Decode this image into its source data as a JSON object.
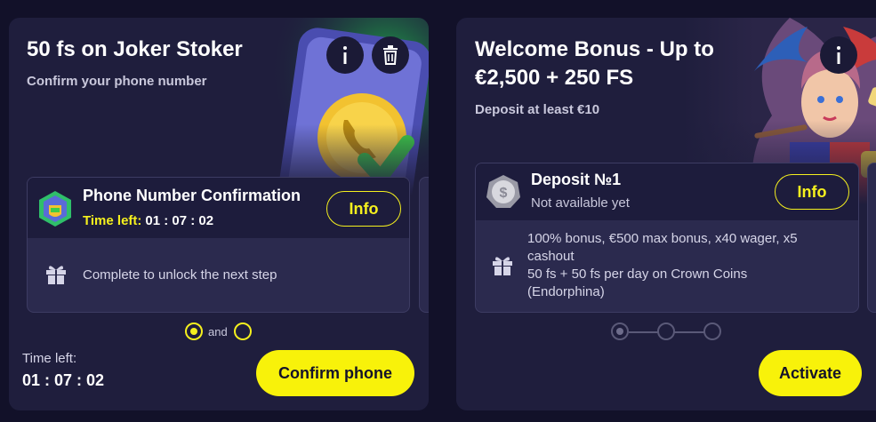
{
  "cards": [
    {
      "title": "50 fs on Joker Stoker",
      "subtitle": "Confirm your phone number",
      "step": {
        "title": "Phone Number Confirmation",
        "time_label": "Time left:",
        "time_value": "01 : 07 : 02",
        "info_label": "Info",
        "description": "Complete to unlock the next step"
      },
      "and_label": "and",
      "time_left_label": "Time left:",
      "time_left_value": "01 : 07 : 02",
      "action_label": "Confirm phone"
    },
    {
      "title": "Welcome Bonus - Up to €2,500 + 250 FS",
      "subtitle": "Deposit at least €10",
      "step": {
        "title": "Deposit №1",
        "status": "Not available yet",
        "info_label": "Info",
        "description_line1": "100% bonus, €500 max bonus, x40 wager, x5",
        "description_line2": "cashout",
        "description_line3": "50 fs + 50 fs per day on Crown Coins",
        "description_line4": "(Endorphina)"
      },
      "action_label": "Activate"
    }
  ],
  "colors": {
    "accent_yellow": "#f8f20a",
    "background": "#121129",
    "card": "#1f1e3d",
    "green_glow": "#1fb24a"
  },
  "icons": [
    "info-icon",
    "trash-icon",
    "gift-icon",
    "phone-badge-icon",
    "coin-icon"
  ]
}
